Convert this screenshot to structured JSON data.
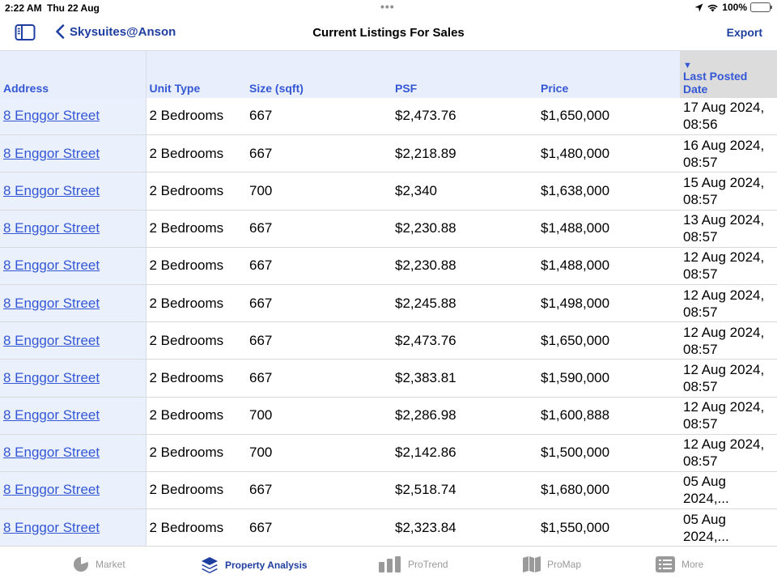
{
  "status_bar": {
    "time": "2:22 AM",
    "date": "Thu 22 Aug",
    "battery": "100%"
  },
  "nav": {
    "back_label": "Skysuites@Anson",
    "title": "Current Listings For Sales",
    "export_label": "Export"
  },
  "table": {
    "headers": {
      "address": "Address",
      "unit_type": "Unit Type",
      "size": "Size (sqft)",
      "psf": "PSF",
      "price": "Price",
      "date": "Last Posted Date",
      "sort_indicator": "▼"
    },
    "rows": [
      {
        "address": "8 Enggor Street",
        "unit_type": "2 Bedrooms",
        "size": "667",
        "psf": "$2,473.76",
        "price": "$1,650,000",
        "date": "17 Aug 2024, 08:56"
      },
      {
        "address": "8 Enggor Street",
        "unit_type": "2 Bedrooms",
        "size": "667",
        "psf": "$2,218.89",
        "price": "$1,480,000",
        "date": "16 Aug 2024, 08:57"
      },
      {
        "address": "8 Enggor Street",
        "unit_type": "2 Bedrooms",
        "size": "700",
        "psf": "$2,340",
        "price": "$1,638,000",
        "date": "15 Aug 2024, 08:57"
      },
      {
        "address": "8 Enggor Street",
        "unit_type": "2 Bedrooms",
        "size": "667",
        "psf": "$2,230.88",
        "price": "$1,488,000",
        "date": "13 Aug 2024, 08:57"
      },
      {
        "address": "8 Enggor Street",
        "unit_type": "2 Bedrooms",
        "size": "667",
        "psf": "$2,230.88",
        "price": "$1,488,000",
        "date": "12 Aug 2024, 08:57"
      },
      {
        "address": "8 Enggor Street",
        "unit_type": "2 Bedrooms",
        "size": "667",
        "psf": "$2,245.88",
        "price": "$1,498,000",
        "date": "12 Aug 2024, 08:57"
      },
      {
        "address": "8 Enggor Street",
        "unit_type": "2 Bedrooms",
        "size": "667",
        "psf": "$2,473.76",
        "price": "$1,650,000",
        "date": "12 Aug 2024, 08:57"
      },
      {
        "address": "8 Enggor Street",
        "unit_type": "2 Bedrooms",
        "size": "667",
        "psf": "$2,383.81",
        "price": "$1,590,000",
        "date": "12 Aug 2024, 08:57"
      },
      {
        "address": "8 Enggor Street",
        "unit_type": "2 Bedrooms",
        "size": "700",
        "psf": "$2,286.98",
        "price": "$1,600,888",
        "date": "12 Aug 2024, 08:57"
      },
      {
        "address": "8 Enggor Street",
        "unit_type": "2 Bedrooms",
        "size": "700",
        "psf": "$2,142.86",
        "price": "$1,500,000",
        "date": "12 Aug 2024, 08:57"
      },
      {
        "address": "8 Enggor Street",
        "unit_type": "2 Bedrooms",
        "size": "667",
        "psf": "$2,518.74",
        "price": "$1,680,000",
        "date": "05 Aug 2024,..."
      },
      {
        "address": "8 Enggor Street",
        "unit_type": "2 Bedrooms",
        "size": "667",
        "psf": "$2,323.84",
        "price": "$1,550,000",
        "date": "05 Aug 2024,..."
      }
    ]
  },
  "tabs": [
    {
      "label": "Market",
      "icon": "pie-chart-icon",
      "active": false
    },
    {
      "label": "Property Analysis",
      "icon": "layers-icon",
      "active": true
    },
    {
      "label": "ProTrend",
      "icon": "bar-chart-icon",
      "active": false
    },
    {
      "label": "ProMap",
      "icon": "map-icon",
      "active": false
    },
    {
      "label": "More",
      "icon": "list-icon",
      "active": false
    }
  ],
  "colors": {
    "accent": "#1f3fa0",
    "link": "#3457d5",
    "header_bg": "#e8eefb",
    "inactive": "#9a9a9a"
  }
}
